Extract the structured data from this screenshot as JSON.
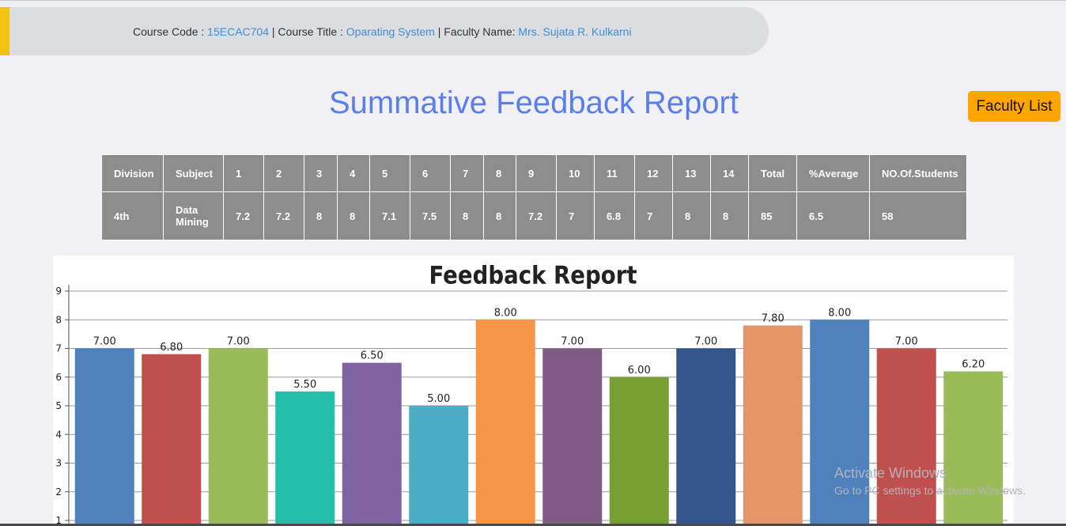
{
  "header": {
    "course_code_label": "Course Code :",
    "course_code": "15ECAC704",
    "course_title_label": "Course Title :",
    "course_title": "Oparating System",
    "faculty_label": "Faculty Name:",
    "faculty_name": "Mrs. Sujata R. Kulkarni",
    "separator": "|"
  },
  "page_title": "Summative Feedback Report",
  "faculty_list_button": "Faculty List",
  "table": {
    "headers": [
      "Division",
      "Subject",
      "1",
      "2",
      "3",
      "4",
      "5",
      "6",
      "7",
      "8",
      "9",
      "10",
      "11",
      "12",
      "13",
      "14",
      "Total",
      "%Average",
      "NO.Of.Students"
    ],
    "rows": [
      [
        "4th",
        "Data Mining",
        "7.2",
        "7.2",
        "8",
        "8",
        "7.1",
        "7.5",
        "8",
        "8",
        "7.2",
        "7",
        "6.8",
        "7",
        "8",
        "8",
        "85",
        "6.5",
        "58"
      ]
    ]
  },
  "chart_data": {
    "type": "bar",
    "title": "Feedback Report",
    "values": [
      7.0,
      6.8,
      7.0,
      5.5,
      6.5,
      5.0,
      8.0,
      7.0,
      6.0,
      7.0,
      7.8,
      8.0,
      7.0,
      6.2
    ],
    "labels": [
      "7.00",
      "6.80",
      "7.00",
      "5.50",
      "6.50",
      "5.00",
      "8.00",
      "7.00",
      "6.00",
      "7.00",
      "7.80",
      "8.00",
      "7.00",
      "6.20"
    ],
    "colors": [
      "#4f81bd",
      "#c0504d",
      "#9bbb59",
      "#23bfaa",
      "#8064a2",
      "#4bacc6",
      "#f79646",
      "#7f5c83",
      "#77a033",
      "#33558b",
      "#e6946a",
      "#4f81bd",
      "#c0504d",
      "#9bbb59"
    ],
    "yticks": [
      "1",
      "2",
      "3",
      "4",
      "5",
      "6",
      "7",
      "8",
      "9"
    ],
    "ylim": [
      0,
      9
    ],
    "grid": true
  },
  "watermark": {
    "line1": "Activate Windows",
    "line2": "Go to PC settings to activate Windows."
  }
}
